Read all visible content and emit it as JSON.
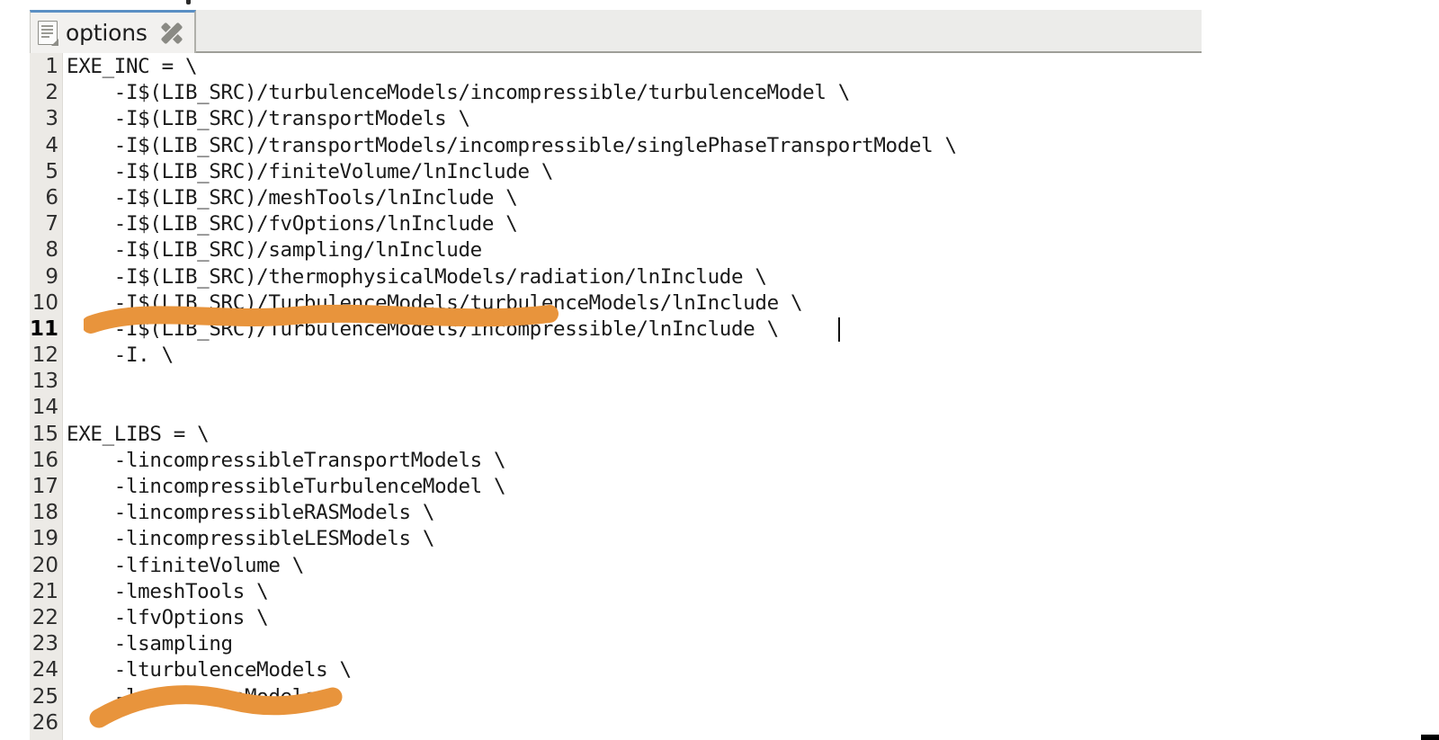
{
  "window": {
    "type": "text-editor",
    "accent_color": "#5a8fc4",
    "tab_bar_bg": "#ececea",
    "code_bg": "#ffffff",
    "gutter_bg": "#eceae6",
    "text_color": "#1a1a1a",
    "marker_color": "#e8943c"
  },
  "tab": {
    "label": "options",
    "icon": "document-icon",
    "close_icon": "close-x-icon",
    "active": true
  },
  "editor": {
    "current_line": 11,
    "caret_line": 11,
    "total_visible_lines": 26,
    "lines": [
      {
        "n": "1",
        "text": "EXE_INC = \\"
      },
      {
        "n": "2",
        "text": "    -I$(LIB_SRC)/turbulenceModels/incompressible/turbulenceModel \\"
      },
      {
        "n": "3",
        "text": "    -I$(LIB_SRC)/transportModels \\"
      },
      {
        "n": "4",
        "text": "    -I$(LIB_SRC)/transportModels/incompressible/singlePhaseTransportModel \\"
      },
      {
        "n": "5",
        "text": "    -I$(LIB_SRC)/finiteVolume/lnInclude \\"
      },
      {
        "n": "6",
        "text": "    -I$(LIB_SRC)/meshTools/lnInclude \\"
      },
      {
        "n": "7",
        "text": "    -I$(LIB_SRC)/fvOptions/lnInclude \\"
      },
      {
        "n": "8",
        "text": "    -I$(LIB_SRC)/sampling/lnInclude"
      },
      {
        "n": "9",
        "text": "    -I$(LIB_SRC)/thermophysicalModels/radiation/lnInclude \\"
      },
      {
        "n": "10",
        "text": "    -I$(LIB_SRC)/TurbulenceModels/turbulenceModels/lnInclude \\"
      },
      {
        "n": "11",
        "text": "    -I$(LIB_SRC)/TurbulenceModels/incompressible/lnInclude \\"
      },
      {
        "n": "12",
        "text": "    -I. \\"
      },
      {
        "n": "13",
        "text": ""
      },
      {
        "n": "14",
        "text": ""
      },
      {
        "n": "15",
        "text": "EXE_LIBS = \\"
      },
      {
        "n": "16",
        "text": "    -lincompressibleTransportModels \\"
      },
      {
        "n": "17",
        "text": "    -lincompressibleTurbulenceModel \\"
      },
      {
        "n": "18",
        "text": "    -lincompressibleRASModels \\"
      },
      {
        "n": "19",
        "text": "    -lincompressibleLESModels \\"
      },
      {
        "n": "20",
        "text": "    -lfiniteVolume \\"
      },
      {
        "n": "21",
        "text": "    -lmeshTools \\"
      },
      {
        "n": "22",
        "text": "    -lfvOptions \\"
      },
      {
        "n": "23",
        "text": "    -lsampling"
      },
      {
        "n": "24",
        "text": "    -lturbulenceModels \\"
      },
      {
        "n": "25",
        "text": "    -lradiationModels \\"
      },
      {
        "n": "26",
        "text": ""
      }
    ]
  },
  "annotations": [
    {
      "name": "highlight-stroke-sampling-include",
      "color": "#e8943c",
      "target_line": 8
    },
    {
      "name": "highlight-stroke-lsampling",
      "color": "#e8943c",
      "target_line": 23
    }
  ]
}
